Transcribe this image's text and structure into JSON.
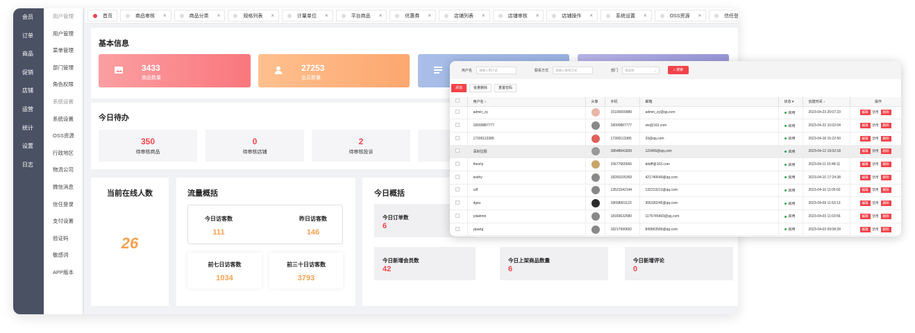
{
  "nav1": [
    "会员",
    "订单",
    "商品",
    "促销",
    "店铺",
    "运营",
    "统计",
    "设置",
    "日志"
  ],
  "nav2": [
    "用户管理",
    "用户管理",
    "菜单管理",
    "部门管理",
    "角色权限",
    "系统设置",
    "系统设置",
    "OSS资源",
    "行政地区",
    "物流公司",
    "微信消息",
    "信任登录",
    "支付设置",
    "验证码",
    "敏感词",
    "APP版本"
  ],
  "tabs": [
    "首页",
    "商品审核",
    "商品分类",
    "规格列表",
    "计量单位",
    "平台商品",
    "优惠券",
    "店铺列表",
    "店铺审核",
    "店铺操作",
    "系统设置",
    "OSS资源",
    "信任登录"
  ],
  "basic": {
    "title": "基本信息",
    "stats": [
      {
        "value": "3433",
        "label": "商品数量"
      },
      {
        "value": "27253",
        "label": "会员数量"
      }
    ]
  },
  "todo": {
    "title": "今日待办",
    "items": [
      {
        "value": "350",
        "label": "待审核商品"
      },
      {
        "value": "0",
        "label": "待审核店铺"
      },
      {
        "value": "2",
        "label": "待审核投诉"
      }
    ]
  },
  "online": {
    "title": "当前在线人数",
    "value": "26"
  },
  "traffic": {
    "title": "流量概括",
    "today_label": "今日访客数",
    "today": "111",
    "yesterday_label": "昨日访客数",
    "yesterday": "146",
    "week_label": "前七日访客数",
    "week": "1034",
    "month_label": "前三十日访客数",
    "month": "3793"
  },
  "overview": {
    "title": "今日概括",
    "items": [
      {
        "label": "今日订单数",
        "value": "6"
      },
      {
        "label": "今日新增会员数",
        "value": "42"
      },
      {
        "label": "今日上架商品数量",
        "value": "6"
      },
      {
        "label": "今日新增评论",
        "value": "0"
      }
    ]
  },
  "popup": {
    "filters": {
      "user_label": "用户名",
      "user_placeholder": "请输入用户名",
      "contact_label": "联系方式",
      "contact_placeholder": "请输入联系方式",
      "dept_label": "部门",
      "dept_placeholder": "请选择",
      "search": "搜索"
    },
    "actions": {
      "add": "添加",
      "batch_delete": "批量删除",
      "reset_pwd": "重置密码"
    },
    "columns": [
      "用户名 ↕",
      "头像",
      "手机",
      "邮箱",
      "状态 ▾",
      "创建时间 ↓",
      "操作"
    ],
    "status": "启用",
    "ops": {
      "edit": "编辑",
      "disable": "禁用",
      "delete": "删除"
    },
    "rows": [
      {
        "name": "admin_zy",
        "phone": "15100000989",
        "email": "admin_zy@qq.com",
        "time": "2023-04-23 20:07:23"
      },
      {
        "name": "18000887777",
        "phone": "18000887777",
        "email": "xie@163.com",
        "time": "2023-04-22 10:02:04"
      },
      {
        "name": "17300113385",
        "phone": "17300113385",
        "email": "33@qq.com",
        "time": "2023-04-18 15:22:50"
      },
      {
        "name": "深圳拉隔",
        "phone": "18648641839",
        "email": "123456@qq.com",
        "time": "2023-04-12 19:02:18"
      },
      {
        "name": "theshy",
        "phone": "15677665566",
        "email": "dddff@163.com",
        "time": "2023-04-11 15:48:11"
      },
      {
        "name": "testhy",
        "phone": "18260105369",
        "email": "421740649@qq.com",
        "time": "2023-04-10 17:24:38"
      },
      {
        "name": "cdf",
        "phone": "13521542144",
        "email": "132213213@qq.com",
        "time": "2023-04-10 11:05:02"
      },
      {
        "name": "dgsu",
        "phone": "18658901123",
        "email": "306330245@qq.com",
        "time": "2023-04-09 11:53:13"
      },
      {
        "name": "ydadmin",
        "phone": "18183632580",
        "email": "1175745493@qq.com",
        "time": "2023-04-03 11:03:56"
      },
      {
        "name": "yipang",
        "phone": "18217990692",
        "email": "849863589@qq.com",
        "time": "2023-04-03 09:08:39"
      }
    ]
  }
}
